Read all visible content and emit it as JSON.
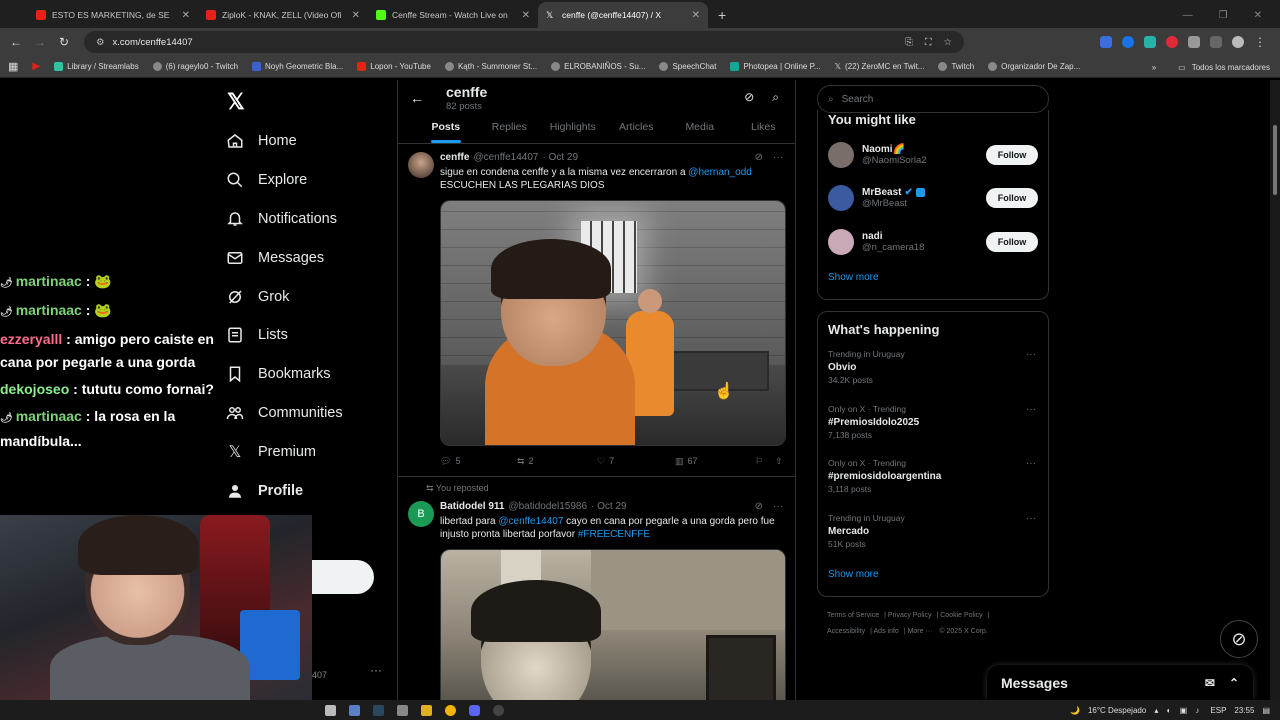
{
  "browser": {
    "tabs": [
      {
        "title": "ESTO ES MARKETING, de SE",
        "color": "#e62117",
        "active": false
      },
      {
        "title": "ZiploK - KNAK, ZELL (Video Ofi",
        "color": "#e62117",
        "active": false
      },
      {
        "title": "Cenffe Stream - Watch Live on",
        "color": "#53fc18",
        "active": false
      },
      {
        "title": "cenffe (@cenffe14407) / X",
        "color": "#ffffff",
        "active": true
      }
    ],
    "url": "x.com/cenffe14407",
    "bookmarks": [
      "Library / Streamlabs",
      "(6) rageylo0 - Twitch",
      "Noyh Geometric Bla...",
      "Lopon - YouTube",
      "Kąth - Summoner St...",
      "ELROBANIÑOS - Su...",
      "SpeechChat",
      "Photopea | Online P...",
      "(22) ZeroMC en Twit...",
      "Twitch",
      "Organizador De Zap..."
    ],
    "all_bookmarks": "Todos los marcadores"
  },
  "nav": {
    "items": [
      {
        "label": "Home",
        "icon": "home-icon"
      },
      {
        "label": "Explore",
        "icon": "search-icon"
      },
      {
        "label": "Notifications",
        "icon": "bell-icon"
      },
      {
        "label": "Messages",
        "icon": "mail-icon"
      },
      {
        "label": "Grok",
        "icon": "grok-icon"
      },
      {
        "label": "Lists",
        "icon": "list-icon"
      },
      {
        "label": "Bookmarks",
        "icon": "bookmark-icon"
      },
      {
        "label": "Communities",
        "icon": "people-icon"
      },
      {
        "label": "Premium",
        "icon": "x-icon"
      },
      {
        "label": "Profile",
        "icon": "person-icon"
      }
    ],
    "handle_partial": "407"
  },
  "chat": [
    {
      "user": "martinaac",
      "color": "#7fd17a",
      "text": " : 🐸"
    },
    {
      "user": "martinaac",
      "color": "#7fd17a",
      "text": " : 🐸"
    },
    {
      "user": "ezzeryalll",
      "color": "#ff6b8a",
      "text": " : amigo pero caiste en cana por pegarle a una gorda"
    },
    {
      "user": "dekojoseo",
      "color": "#8bf08b",
      "text": " : tututu como fornai?"
    },
    {
      "user": "martinaac",
      "color": "#7fd17a",
      "text": " : la rosa en la mandíbula..."
    }
  ],
  "profile": {
    "name": "cenffe",
    "posts_count": "82 posts"
  },
  "profile_tabs": [
    "Posts",
    "Replies",
    "Highlights",
    "Articles",
    "Media",
    "Likes"
  ],
  "tweets": [
    {
      "name": "cenffe",
      "handle": "@cenffe14407",
      "date": "· Oct 29",
      "text_before": "sigue en condena cenffe y a la misma vez encerraron a ",
      "mention": "@hernan_odd",
      "text_after": "ESCUCHEN LAS PLEGARIAS DIOS",
      "replies": "5",
      "reposts": "2",
      "likes": "7",
      "views": "67"
    },
    {
      "reposted_by": "You reposted",
      "avatar_letter": "B",
      "name": "Batidodel 911",
      "handle": "@batidodel15986",
      "date": "· Oct 29",
      "text_before": "libertad para ",
      "mention": "@cenffe14407",
      "text_mid": " cayo en cana por pegarle a una gorda pero fue injusto  pronta libertad porfavor ",
      "hashtag": "#FREECENFFE"
    }
  ],
  "right": {
    "search_placeholder": "Search",
    "you_might_like": "You might like",
    "suggestions": [
      {
        "name": "Naomi🌈",
        "handle": "@NaomiSorla2",
        "avatar_color": "#7a6e6a"
      },
      {
        "name": "MrBeast",
        "handle": "@MrBeast",
        "avatar_color": "#3b5aa0"
      },
      {
        "name": "nadi",
        "handle": "@n_camera18",
        "avatar_color": "#c9a9b8"
      }
    ],
    "follow_label": "Follow",
    "show_more": "Show more",
    "whats_happening": "What's happening",
    "trends": [
      {
        "context": "Trending in Uruguay",
        "title": "Obvio",
        "posts": "34.2K posts"
      },
      {
        "context": "Only on X · Trending",
        "title": "#PremiosIdolo2025",
        "posts": "7,138 posts"
      },
      {
        "context": "Only on X · Trending",
        "title": "#premiosidoloargentina",
        "posts": "3,118 posts"
      },
      {
        "context": "Trending in Uruguay",
        "title": "Mercado",
        "posts": "51K posts"
      }
    ],
    "footer": [
      "Terms of Service",
      "Privacy Policy",
      "Cookie Policy",
      "Accessibility",
      "Ads info",
      "More ···",
      "© 2025 X Corp."
    ]
  },
  "messages_drawer": "Messages",
  "taskbar": {
    "weather": "16°C  Despejado",
    "lang": "ESP",
    "time": "23:55"
  }
}
